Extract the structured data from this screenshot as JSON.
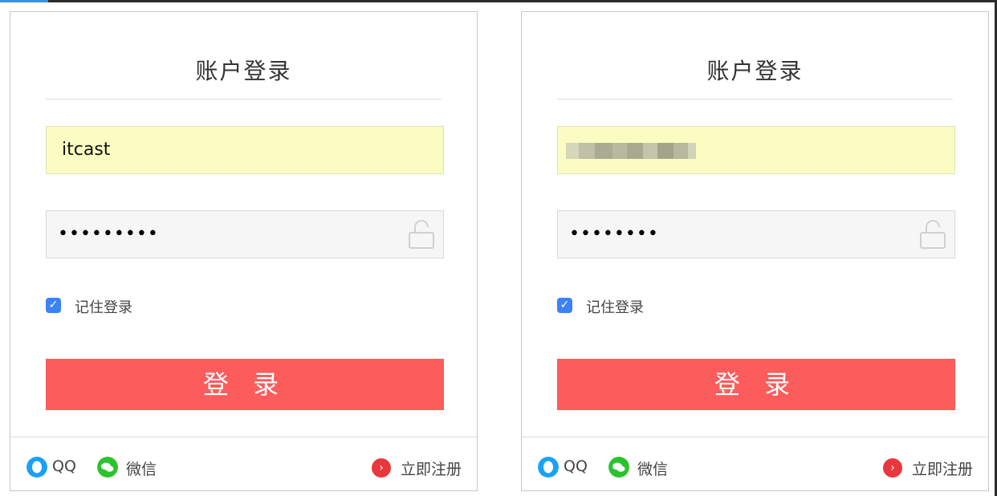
{
  "panels": [
    {
      "title": "账户登录",
      "username": "itcast",
      "password_mask": "•••••••••",
      "remember_label": "记住登录",
      "remember_checked": true,
      "login_button": "登 录",
      "qq_label": "QQ",
      "wechat_label": "微信",
      "register_label": "立即注册"
    },
    {
      "title": "账户登录",
      "username": "",
      "password_mask": "••••••••",
      "remember_label": "记住登录",
      "remember_checked": true,
      "login_button": "登 录",
      "qq_label": "QQ",
      "wechat_label": "微信",
      "register_label": "立即注册"
    }
  ],
  "icons": {
    "lock": "lock-icon",
    "qq": "qq-icon",
    "wechat": "wechat-icon",
    "register": "chevron-right-icon",
    "checkbox": "checkmark-icon"
  },
  "colors": {
    "login_button": "#fd5c5c",
    "username_field_bg": "#fafcc1",
    "password_field_bg": "#f6f6f6",
    "checkbox": "#3b82f6",
    "qq": "#1aa1f5",
    "wechat": "#2bc22b",
    "register_icon": "#e8383d"
  }
}
